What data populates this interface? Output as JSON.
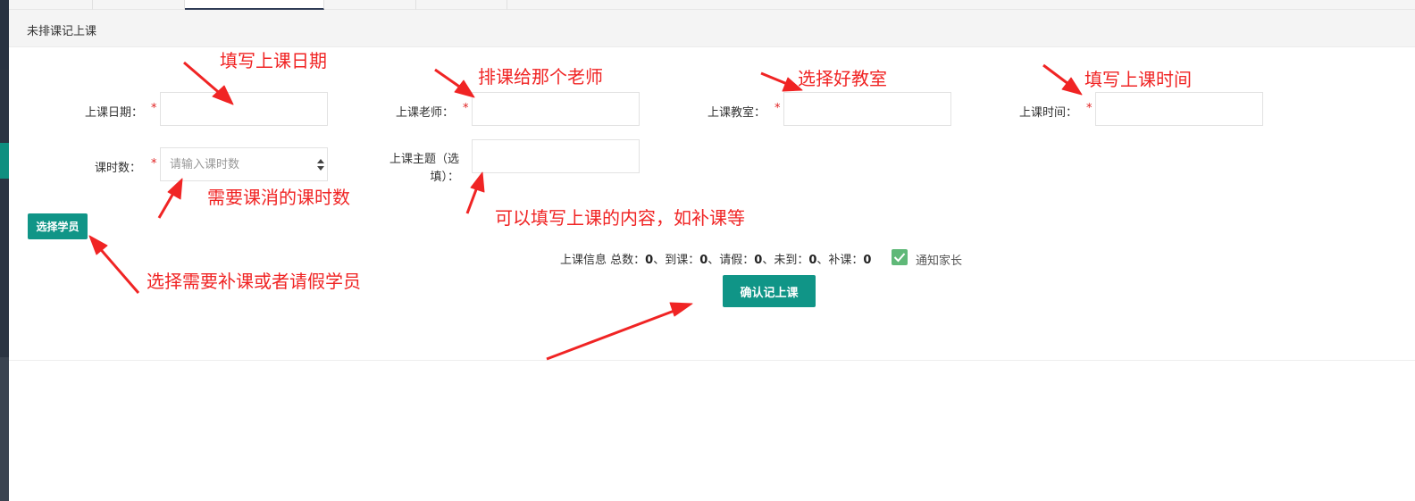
{
  "panel": {
    "title": "未排课记上课"
  },
  "form": {
    "date": {
      "label": "上课日期：",
      "required": "*",
      "value": ""
    },
    "teacher": {
      "label": "上课老师：",
      "required": "*",
      "value": ""
    },
    "room": {
      "label": "上课教室：",
      "required": "*",
      "value": ""
    },
    "time": {
      "label": "上课时间：",
      "required": "*",
      "value": ""
    },
    "hours": {
      "label": "课时数：",
      "required": "*",
      "placeholder": "请输入课时数",
      "value": ""
    },
    "topic": {
      "label_line1": "上课主题（选",
      "label_line2": "填）：",
      "value": ""
    }
  },
  "buttons": {
    "select_students": "选择学员",
    "confirm": "确认记上课"
  },
  "summary": {
    "prefix": "上课信息 总数：",
    "total": "0",
    "attended_label": "、到课：",
    "attended": "0",
    "leave_label": "、请假：",
    "leave": "0",
    "absent_label": "、未到：",
    "absent": "0",
    "makeup_label": "、补课：",
    "makeup": "0",
    "notify_parents": "通知家长",
    "notify_checked": true
  },
  "annotations": {
    "date": "填写上课日期",
    "teacher": "排课给那个老师",
    "room": "选择好教室",
    "time": "填写上课时间",
    "hours": "需要课消的课时数",
    "topic": "可以填写上课的内容，如补课等",
    "students": "选择需要补课或者请假学员"
  },
  "colors": {
    "accent": "#109587",
    "annotation": "#f02424",
    "required": "#e02020",
    "checkbox": "#5fb878"
  }
}
